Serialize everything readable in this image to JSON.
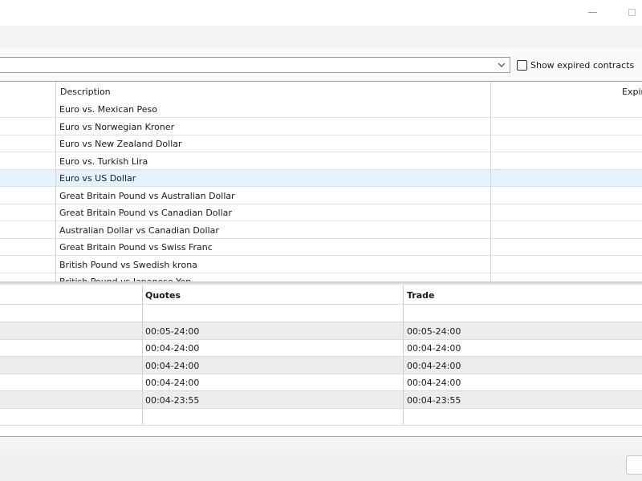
{
  "window": {
    "minimize_label": "",
    "maximize_label": ""
  },
  "filter": {
    "symbol_value": "",
    "show_expired_label": "Show expired contracts",
    "show_expired_checked": false
  },
  "symbols_table": {
    "columns": [
      "Description",
      "Expir"
    ],
    "rows": [
      {
        "description": "Euro vs. Mexican Peso",
        "expiration": ""
      },
      {
        "description": "Euro vs Norwegian Kroner",
        "expiration": ""
      },
      {
        "description": "Euro vs New Zealand Dollar",
        "expiration": ""
      },
      {
        "description": "Euro vs. Turkish Lira",
        "expiration": ""
      },
      {
        "description": "Euro vs US Dollar",
        "expiration": "",
        "selected": true
      },
      {
        "description": "Great Britain Pound vs Australian Dollar",
        "expiration": ""
      },
      {
        "description": "Great Britain Pound vs Canadian Dollar",
        "expiration": ""
      },
      {
        "description": "Australian Dollar vs Canadian Dollar",
        "expiration": ""
      },
      {
        "description": "Great Britain Pound vs Swiss Franc",
        "expiration": ""
      },
      {
        "description": "British Pound vs Swedish krona",
        "expiration": ""
      },
      {
        "description": "British Pound vs Japanese Yen",
        "expiration": ""
      }
    ]
  },
  "sessions_table": {
    "columns": [
      "Quotes",
      "Trade"
    ],
    "rows": [
      {
        "quotes": "",
        "trade": ""
      },
      {
        "quotes": "00:05-24:00",
        "trade": "00:05-24:00"
      },
      {
        "quotes": "00:04-24:00",
        "trade": "00:04-24:00"
      },
      {
        "quotes": "00:04-24:00",
        "trade": "00:04-24:00"
      },
      {
        "quotes": "00:04-24:00",
        "trade": "00:04-24:00"
      },
      {
        "quotes": "00:04-23:55",
        "trade": "00:04-23:55"
      },
      {
        "quotes": "",
        "trade": ""
      }
    ]
  },
  "colors": {
    "selected_row": "#e6f2fb",
    "alt_row": "#ececec",
    "window_bg": "#f0f0f0"
  }
}
